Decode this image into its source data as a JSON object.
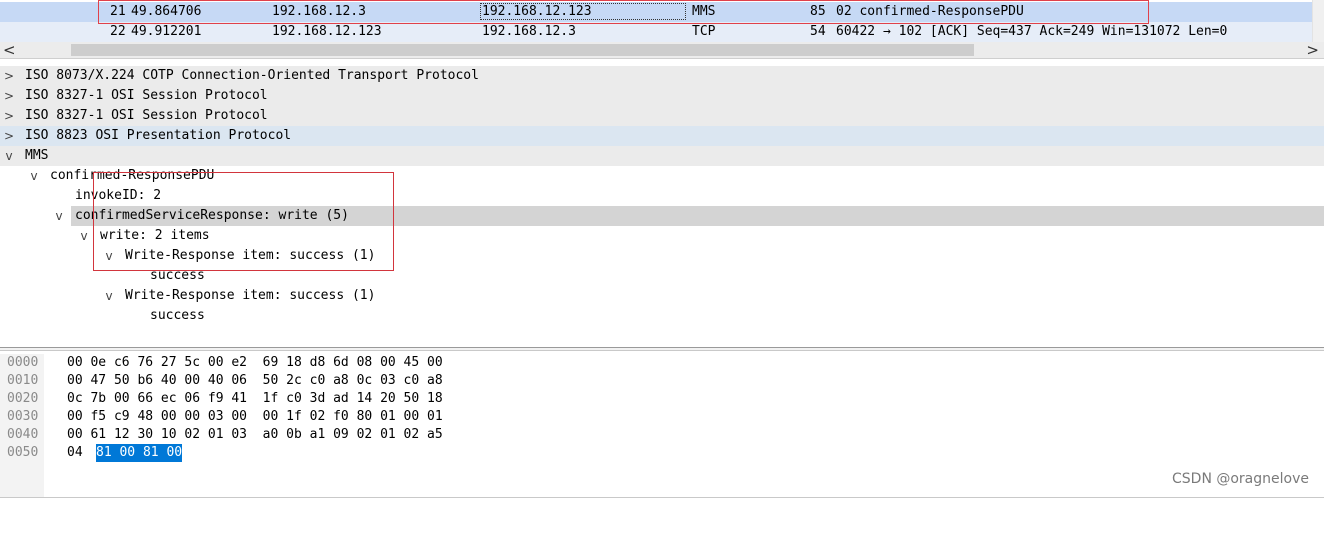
{
  "packet_list": {
    "rows": [
      {
        "no": "21",
        "time": "49.864706",
        "source": "192.168.12.3",
        "destination": "192.168.12.123",
        "protocol": "MMS",
        "length": "85",
        "info": "02 confirmed-ResponsePDU"
      },
      {
        "no": "22",
        "time": "49.912201",
        "source": "192.168.12.123",
        "destination": "192.168.12.3",
        "protocol": "TCP",
        "length": "54",
        "info": "60422 → 102 [ACK] Seq=437 Ack=249 Win=131072 Len=0"
      }
    ]
  },
  "scroll": {
    "left_arrow": "<",
    "right_arrow": ">"
  },
  "detail_tree": {
    "nodes": [
      {
        "toggle": ">",
        "text": "ISO 8073/X.224 COTP Connection-Oriented Transport Protocol"
      },
      {
        "toggle": ">",
        "text": "ISO 8327-1 OSI Session Protocol"
      },
      {
        "toggle": ">",
        "text": "ISO 8327-1 OSI Session Protocol"
      },
      {
        "toggle": ">",
        "text": "ISO 8823 OSI Presentation Protocol"
      },
      {
        "toggle": "v",
        "text": "MMS"
      },
      {
        "toggle": "v",
        "text": "confirmed-ResponsePDU"
      },
      {
        "toggle": "",
        "text": "invokeID: 2"
      },
      {
        "toggle": "v",
        "text": "confirmedServiceResponse: write (5)"
      },
      {
        "toggle": "v",
        "text": "write: 2 items"
      },
      {
        "toggle": "v",
        "text": "Write-Response item: success (1)"
      },
      {
        "toggle": "",
        "text": "success"
      },
      {
        "toggle": "v",
        "text": "Write-Response item: success (1)"
      },
      {
        "toggle": "",
        "text": "success"
      }
    ]
  },
  "hex_dump": {
    "rows": [
      {
        "offset": "0000",
        "bytes": "00 0e c6 76 27 5c 00 e2  69 18 d8 6d 08 00 45 00"
      },
      {
        "offset": "0010",
        "bytes": "00 47 50 b6 40 00 40 06  50 2c c0 a8 0c 03 c0 a8"
      },
      {
        "offset": "0020",
        "bytes": "0c 7b 00 66 ec 06 f9 41  1f c0 3d ad 14 20 50 18"
      },
      {
        "offset": "0030",
        "bytes": "00 f5 c9 48 00 00 03 00  00 1f 02 f0 80 01 00 01"
      },
      {
        "offset": "0040",
        "bytes": "00 61 12 30 10 02 01 03  a0 0b a1 09 02 01 02 a5"
      },
      {
        "offset": "0050",
        "bytes": "04 "
      }
    ],
    "selected_bytes": "81 00 81 00"
  },
  "watermark": "CSDN @oragnelove"
}
